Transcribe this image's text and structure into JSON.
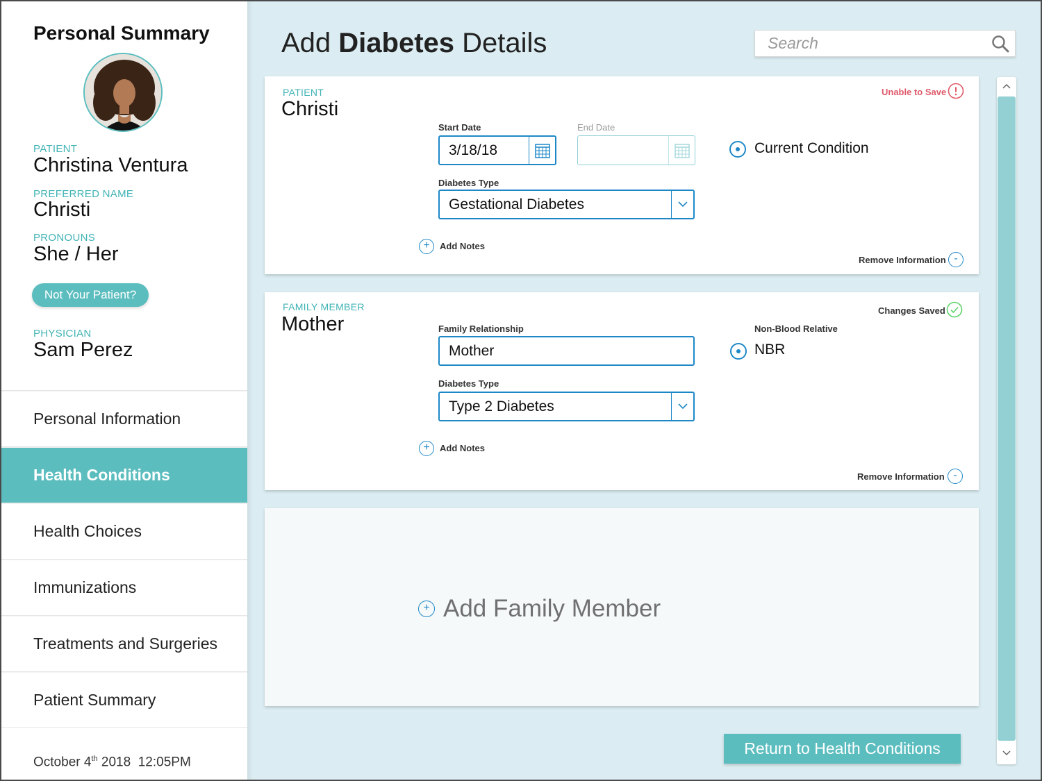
{
  "sidebar": {
    "title": "Personal Summary",
    "patient_label": "PATIENT",
    "patient_name": "Christina Ventura",
    "preferred_label": "PREFERRED NAME",
    "preferred_name": "Christi",
    "pronouns_label": "PRONOUNS",
    "pronouns": "She / Her",
    "not_patient_button": "Not Your Patient?",
    "physician_label": "PHYSICIAN",
    "physician": "Sam Perez",
    "nav": [
      {
        "label": "Personal Information",
        "active": false
      },
      {
        "label": "Health Conditions",
        "active": true
      },
      {
        "label": "Health Choices",
        "active": false
      },
      {
        "label": "Immunizations",
        "active": false
      },
      {
        "label": "Treatments and Surgeries",
        "active": false
      },
      {
        "label": "Patient Summary",
        "active": false
      }
    ],
    "date_month_day": "October 4",
    "date_suffix": "th",
    "date_rest": " 2018  12:05PM"
  },
  "header": {
    "title_prefix": "Add ",
    "title_bold": "Diabetes",
    "title_suffix": " Details",
    "search_placeholder": "Search"
  },
  "patient_card": {
    "label": "PATIENT",
    "name": "Christi",
    "status": "Unable to Save",
    "status_color": "#e05a6a",
    "start_date_label": "Start Date",
    "start_date": "3/18/18",
    "end_date_label": "End Date",
    "end_date": "",
    "current_condition": "Current Condition",
    "diabetes_type_label": "Diabetes Type",
    "diabetes_type": "Gestational Diabetes",
    "add_notes": "Add Notes",
    "remove": "Remove Information"
  },
  "family_card": {
    "label": "FAMILY MEMBER",
    "name": "Mother",
    "status": "Changes Saved",
    "relationship_label": "Family Relationship",
    "relationship": "Mother",
    "non_blood_label": "Non-Blood Relative",
    "nbr": "NBR",
    "diabetes_type_label": "Diabetes Type",
    "diabetes_type": "Type 2 Diabetes",
    "add_notes": "Add Notes",
    "remove": "Remove Information"
  },
  "add_family_member": "Add Family Member",
  "return_button": "Return to Health Conditions",
  "colors": {
    "accent": "#5cbdbf",
    "link_blue": "#1e88c7",
    "background": "#dbedf2",
    "saved_green": "#5fd36a"
  }
}
